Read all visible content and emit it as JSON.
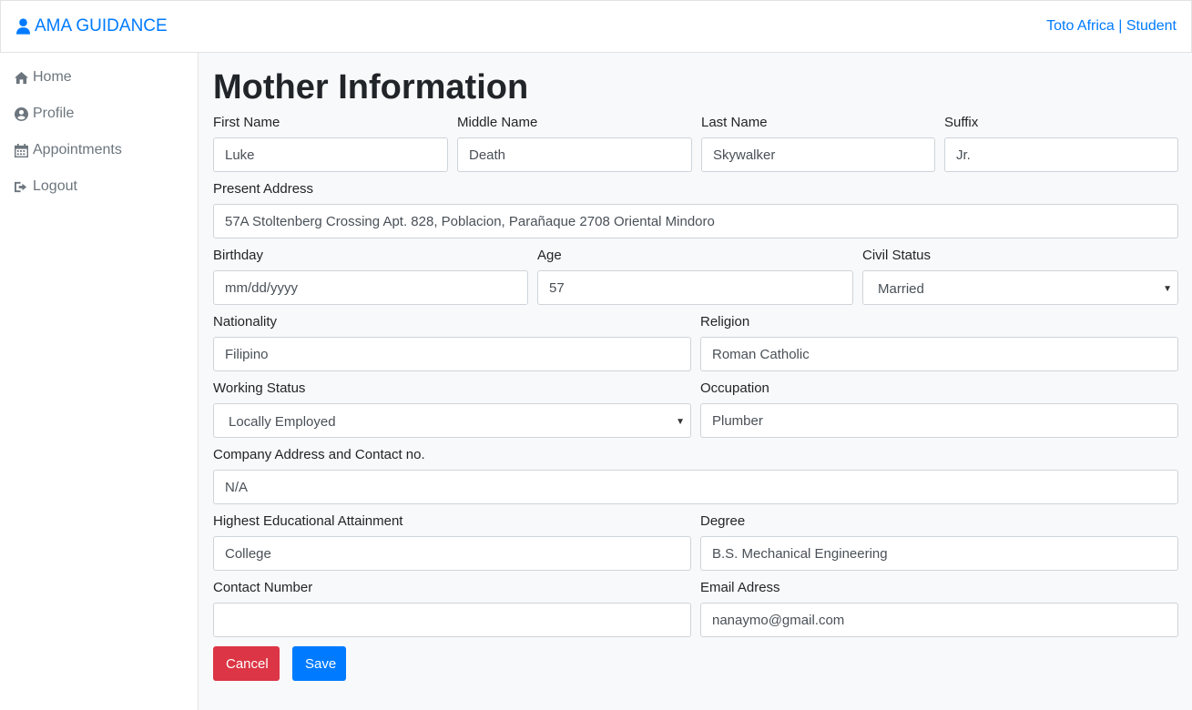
{
  "navbar": {
    "brand": "AMA GUIDANCE",
    "brand_icon": "user-icon",
    "user": "Toto Africa | Student"
  },
  "sidebar": {
    "items": [
      {
        "label": "Home",
        "icon": "home-icon"
      },
      {
        "label": "Profile",
        "icon": "user-circle-icon"
      },
      {
        "label": "Appointments",
        "icon": "calendar-icon"
      },
      {
        "label": "Logout",
        "icon": "sign-out-icon"
      }
    ]
  },
  "form": {
    "title": "Mother Information",
    "first_name": {
      "label": "First Name",
      "value": "Luke"
    },
    "middle_name": {
      "label": "Middle Name",
      "value": "Death"
    },
    "last_name": {
      "label": "Last Name",
      "value": "Skywalker"
    },
    "suffix": {
      "label": "Suffix",
      "value": "Jr."
    },
    "present_address": {
      "label": "Present Address",
      "value": "57A Stoltenberg Crossing Apt. 828, Poblacion, Parañaque 2708 Oriental Mindoro"
    },
    "birthday": {
      "label": "Birthday",
      "placeholder": "mm/dd/yyyy"
    },
    "age": {
      "label": "Age",
      "value": "57"
    },
    "civil_status": {
      "label": "Civil Status",
      "selected": "Married"
    },
    "nationality": {
      "label": "Nationality",
      "value": "Filipino"
    },
    "religion": {
      "label": "Religion",
      "value": "Roman Catholic"
    },
    "working_status": {
      "label": "Working Status",
      "selected": "Locally Employed"
    },
    "occupation": {
      "label": "Occupation",
      "value": "Plumber"
    },
    "company_address": {
      "label": "Company Address and Contact no.",
      "value": "N/A"
    },
    "education": {
      "label": "Highest Educational Attainment",
      "value": "College"
    },
    "degree": {
      "label": "Degree",
      "value": "B.S. Mechanical Engineering"
    },
    "contact_number": {
      "label": "Contact Number",
      "value": ""
    },
    "email": {
      "label": "Email Adress",
      "value": "nanaymo@gmail.com"
    },
    "cancel_label": "Cancel",
    "save_label": "Save"
  },
  "colors": {
    "primary": "#007bff",
    "danger": "#dc3545",
    "muted": "#6c757d",
    "background": "#f8f9fa"
  }
}
